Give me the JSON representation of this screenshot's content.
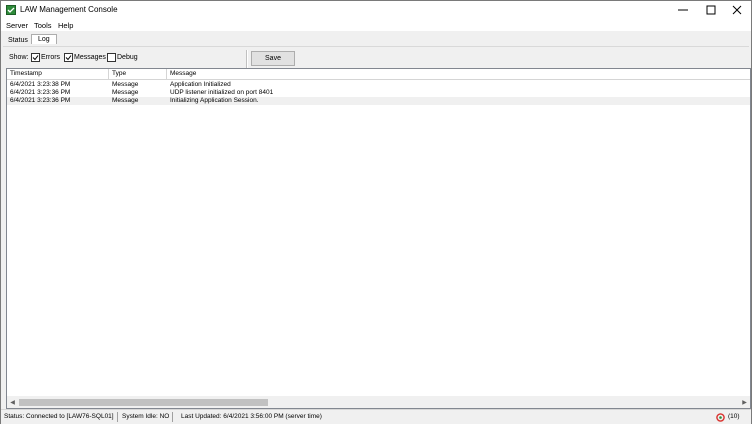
{
  "window": {
    "title": "LAW Management Console"
  },
  "menu": [
    "Server",
    "Tools",
    "Help"
  ],
  "tabs": [
    "Status",
    "Log"
  ],
  "filters": {
    "show_label": "Show:",
    "options": [
      {
        "label": "Errors",
        "checked": true
      },
      {
        "label": "Messages",
        "checked": true
      },
      {
        "label": "Debug",
        "checked": false
      }
    ]
  },
  "toolbar": {
    "save_label": "Save"
  },
  "log_table": {
    "columns": [
      "Timestamp",
      "Type",
      "Message"
    ],
    "rows": [
      {
        "timestamp": "6/4/2021 3:23:38 PM",
        "type": "Message",
        "message": "Application Initialized"
      },
      {
        "timestamp": "6/4/2021 3:23:36 PM",
        "type": "Message",
        "message": "UDP listener initialized on port 8401"
      },
      {
        "timestamp": "6/4/2021 3:23:36 PM",
        "type": "Message",
        "message": "Initializing Application Session."
      }
    ]
  },
  "statusbar": {
    "connection": "Status: Connected to [LAW76-SQL01]",
    "idle": "System Idle: NO",
    "updated": "Last Updated: 6/4/2021 3:56:00 PM (server time)",
    "count": "(10)"
  },
  "colors": {
    "app_icon": "#2e8b3a",
    "status_icon": "#d9302c",
    "selected_row": "#f0f0f0"
  },
  "icons": [
    "app-icon",
    "minimize-icon",
    "maximize-icon",
    "close-icon",
    "check-icon",
    "scroll-left-icon",
    "scroll-right-icon",
    "refresh-status-icon"
  ]
}
